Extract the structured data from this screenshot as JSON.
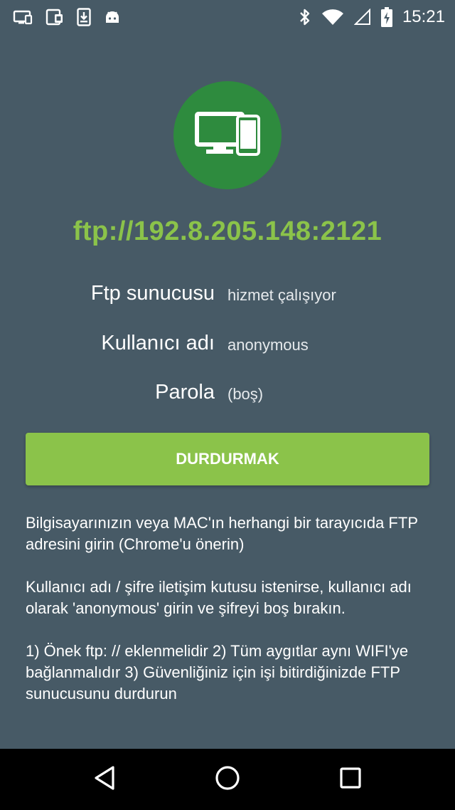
{
  "status_bar": {
    "time": "15:21",
    "left_icons": [
      "cast-screen-icon",
      "phone-screen-icon",
      "download-icon",
      "android-icon"
    ],
    "right_icons": [
      "bluetooth-icon",
      "wifi-icon",
      "cell-signal-icon",
      "battery-charging-icon"
    ]
  },
  "server": {
    "address": "ftp://192.8.205.148:2121",
    "rows": [
      {
        "label": "Ftp sunucusu",
        "value": "hizmet çalışıyor"
      },
      {
        "label": "Kullanıcı adı",
        "value": "anonymous"
      },
      {
        "label": "Parola",
        "value": "(boş)"
      }
    ]
  },
  "actions": {
    "stop_label": "DURDURMAK"
  },
  "instructions": [
    "Bilgisayarınızın veya MAC'ın herhangi bir tarayıcıda FTP adresini girin (Chrome'u önerin)",
    "Kullanıcı adı / şifre iletişim kutusu istenirse, kullanıcı adı olarak 'anonymous' girin ve şifreyi boş bırakın.",
    "1) Önek ftp: // eklenmelidir 2) Tüm aygıtlar aynı WIFI'ye bağlanmalıdır 3) Güvenliğiniz için işi bitirdiğinizde FTP sunucusunu durdurun"
  ],
  "colors": {
    "background": "#475a66",
    "accent": "#8bc34a",
    "hero_circle": "#2e8b3e"
  }
}
